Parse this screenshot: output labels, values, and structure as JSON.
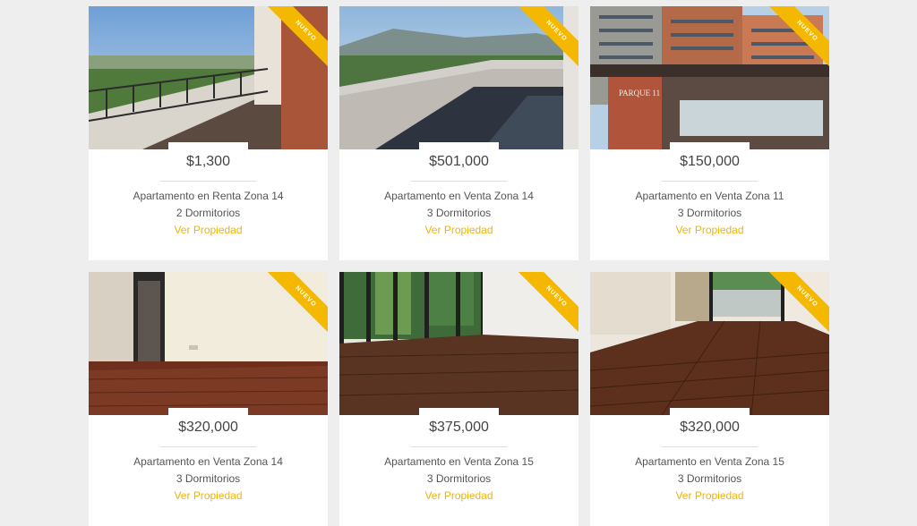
{
  "listings": [
    {
      "price": "$1,300",
      "title": "Apartamento en Renta Zona 14",
      "bedrooms": "2 Dormitorios",
      "link": "Ver Propiedad",
      "badge": "NUEVO"
    },
    {
      "price": "$501,000",
      "title": "Apartamento en Venta Zona 14",
      "bedrooms": "3 Dormitorios",
      "link": "Ver Propiedad",
      "badge": "NUEVO"
    },
    {
      "price": "$150,000",
      "title": "Apartamento en Venta Zona 11",
      "bedrooms": "3 Dormitorios",
      "link": "Ver Propiedad",
      "badge": "NUEVO"
    },
    {
      "price": "$320,000",
      "title": "Apartamento en Venta Zona 14",
      "bedrooms": "3 Dormitorios",
      "link": "Ver Propiedad",
      "badge": "NUEVO"
    },
    {
      "price": "$375,000",
      "title": "Apartamento en Venta Zona 15",
      "bedrooms": "3 Dormitorios",
      "link": "Ver Propiedad",
      "badge": "NUEVO"
    },
    {
      "price": "$320,000",
      "title": "Apartamento en Venta Zona 15",
      "bedrooms": "3 Dormitorios",
      "link": "Ver Propiedad",
      "badge": "NUEVO"
    }
  ],
  "photo_signs": {
    "building_sign": "PARQUE 11"
  },
  "colors": {
    "accent": "#f5b800",
    "link": "#f0b400",
    "background": "#eeeeee"
  }
}
